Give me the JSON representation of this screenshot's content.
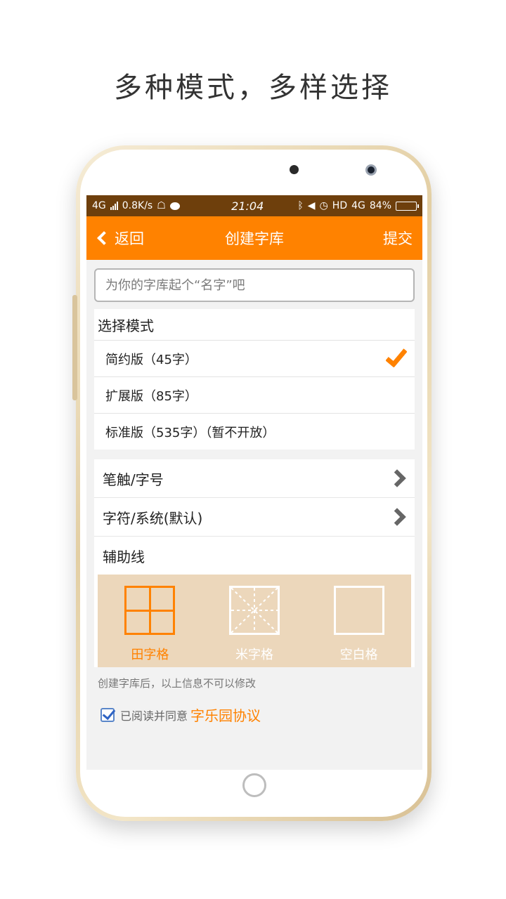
{
  "headline": "多种模式，多样选择",
  "statusbar": {
    "network": "4G",
    "speed": "0.8K/s",
    "time": "21:04",
    "hd": "HD",
    "net2": "4G",
    "battery": "84%",
    "battery_level": 0.84
  },
  "navbar": {
    "back_label": "返回",
    "title": "创建字库",
    "submit_label": "提交"
  },
  "name_input": {
    "placeholder": "为你的字库起个“名字”吧",
    "value": ""
  },
  "mode_section": {
    "title": "选择模式",
    "options": [
      {
        "label": "简约版（45字）",
        "selected": true
      },
      {
        "label": "扩展版（85字）",
        "selected": false
      },
      {
        "label": "标准版（535字）（暂不开放）",
        "selected": false
      }
    ]
  },
  "settings": {
    "stroke_size": "笔触/字号",
    "font_system": "字符/系统(默认)"
  },
  "aux_lines": {
    "title": "辅助线",
    "options": [
      {
        "label": "田字格",
        "selected": true
      },
      {
        "label": "米字格",
        "selected": false
      },
      {
        "label": "空白格",
        "selected": false
      }
    ]
  },
  "notice": "创建字库后，以上信息不可以修改",
  "agreement": {
    "checked": true,
    "text": "已阅读并同意",
    "link_label": "字乐园协议"
  },
  "colors": {
    "accent": "#ff8200",
    "statusbar": "#6e3f0c",
    "grid_bg": "#ecd7bb"
  }
}
